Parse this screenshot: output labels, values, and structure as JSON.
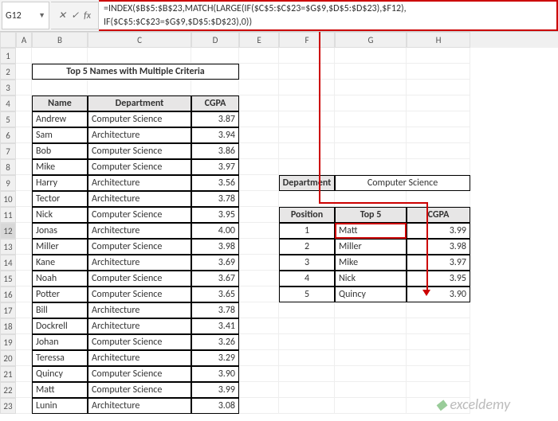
{
  "nameBox": "G12",
  "formula": "=INDEX($B$5:$B$23,MATCH(LARGE(IF($C$5:$C$23=$G$9,$D$5:$D$23),$F12), IF($C$5:$C$23=$G$9,$D$5:$D$23),0))",
  "title": "Top 5 Names with Multiple Criteria",
  "mainHeaders": {
    "name": "Name",
    "dept": "Department",
    "cgpa": "CGPA"
  },
  "mainData": [
    {
      "name": "Andrew",
      "dept": "Computer Science",
      "cgpa": "3.87"
    },
    {
      "name": "Sam",
      "dept": "Architecture",
      "cgpa": "3.94"
    },
    {
      "name": "Bob",
      "dept": "Computer Science",
      "cgpa": "3.86"
    },
    {
      "name": "Mike",
      "dept": "Computer Science",
      "cgpa": "3.97"
    },
    {
      "name": "Harry",
      "dept": "Architecture",
      "cgpa": "3.56"
    },
    {
      "name": "Tector",
      "dept": "Architecture",
      "cgpa": "3.78"
    },
    {
      "name": "Nick",
      "dept": "Computer Science",
      "cgpa": "3.95"
    },
    {
      "name": "Jonas",
      "dept": "Architecture",
      "cgpa": "4.00"
    },
    {
      "name": "Miller",
      "dept": "Computer Science",
      "cgpa": "3.98"
    },
    {
      "name": "Kane",
      "dept": "Architecture",
      "cgpa": "3.69"
    },
    {
      "name": "Noah",
      "dept": "Computer Science",
      "cgpa": "3.67"
    },
    {
      "name": "Potter",
      "dept": "Computer Science",
      "cgpa": "3.65"
    },
    {
      "name": "Bill",
      "dept": "Architecture",
      "cgpa": "3.78"
    },
    {
      "name": "Dockrell",
      "dept": "Architecture",
      "cgpa": "3.41"
    },
    {
      "name": "Johan",
      "dept": "Computer Science",
      "cgpa": "3.26"
    },
    {
      "name": "Teressa",
      "dept": "Architecture",
      "cgpa": "3.29"
    },
    {
      "name": "Quincy",
      "dept": "Computer Science",
      "cgpa": "3.90"
    },
    {
      "name": "Matt",
      "dept": "Computer Science",
      "cgpa": "3.99"
    },
    {
      "name": "Lunin",
      "dept": "Architecture",
      "cgpa": "3.08"
    }
  ],
  "criteria": {
    "label": "Department",
    "value": "Computer Science"
  },
  "top5Headers": {
    "pos": "Position",
    "top5": "Top 5",
    "cgpa": "CGPA"
  },
  "top5Data": [
    {
      "pos": "1",
      "name": "Matt",
      "cgpa": "3.99"
    },
    {
      "pos": "2",
      "name": "Miller",
      "cgpa": "3.98"
    },
    {
      "pos": "3",
      "name": "Mike",
      "cgpa": "3.97"
    },
    {
      "pos": "4",
      "name": "Nick",
      "cgpa": "3.95"
    },
    {
      "pos": "5",
      "name": "Quincy",
      "cgpa": "3.90"
    }
  ],
  "watermark": "exceldemy",
  "cols": [
    "A",
    "B",
    "C",
    "D",
    "E",
    "F",
    "G",
    "H"
  ]
}
